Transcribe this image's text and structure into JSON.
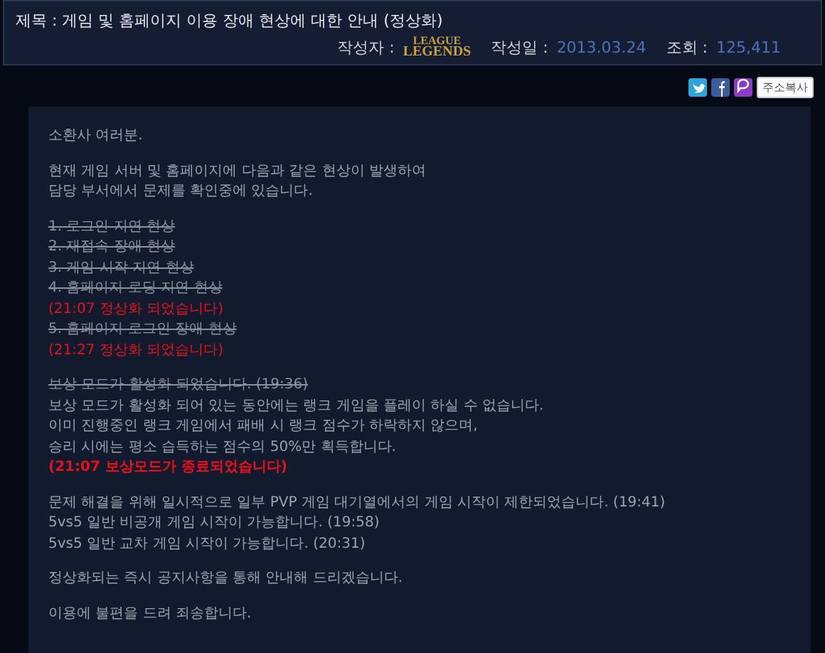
{
  "header": {
    "title": "제목 : 게임 및 홈페이지 이용 장애 현상에 대한 안내 (정상화)",
    "author_label": "작성자 :",
    "author_logo": [
      "LEAGUE",
      "LEGENDS"
    ],
    "date_label": "작성일 :",
    "date": "2013.03.24",
    "views_label": "조회 :",
    "views": "125,411"
  },
  "share": {
    "copy_button": "주소복사"
  },
  "paragraphs": [
    {
      "lines": [
        {
          "kind": "normal",
          "text": "소환사 여러분."
        }
      ]
    },
    {
      "lines": [
        {
          "kind": "normal",
          "text": "현재 게임 서버 및 홈페이지에 다음과 같은 현상이 발생하여"
        },
        {
          "kind": "normal",
          "text": "담당 부서에서 문제를 확인중에 있습니다."
        }
      ]
    },
    {
      "lines": [
        {
          "kind": "struck",
          "text": "1. 로그인 지연 현상"
        },
        {
          "kind": "struck",
          "text": "2. 재접속 장애 현상"
        },
        {
          "kind": "struck",
          "text": "3. 게임 시작 지연 현상"
        },
        {
          "kind": "struck",
          "text": "4. 홈페이지 로딩 지연 현상"
        },
        {
          "kind": "red",
          "text": "(21:07 정상화 되었습니다)"
        },
        {
          "kind": "struck",
          "text": "5. 홈페이지 로그인 장애 현상"
        },
        {
          "kind": "red",
          "text": "(21:27  정상화 되었습니다)"
        }
      ]
    },
    {
      "lines": [
        {
          "kind": "struck",
          "text": "보상 모드가 활성화 되었습니다. (19:36)"
        },
        {
          "kind": "normal",
          "text": "보상 모드가 활성화 되어 있는 동안에는 랭크 게임을 플레이 하실 수 없습니다."
        },
        {
          "kind": "normal",
          "text": "이미 진행중인 랭크 게임에서 패배 시 랭크 점수가 하락하지 않으며,"
        },
        {
          "kind": "normal",
          "text": "승리 시에는 평소 습득하는 점수의 50%만 획득합니다."
        },
        {
          "kind": "red-bold",
          "text": "(21:07 보상모드가 종료되었습니다)"
        }
      ]
    },
    {
      "lines": [
        {
          "kind": "normal",
          "text": "문제 해결을 위해 일시적으로 일부 PVP 게임 대기열에서의 게임 시작이 제한되었습니다. (19:41)"
        },
        {
          "kind": "normal",
          "text": "5vs5 일반 비공개 게임 시작이 가능합니다. (19:58)"
        },
        {
          "kind": "normal",
          "text": "5vs5 일반 교차 게임 시작이 가능합니다. (20:31)"
        }
      ]
    },
    {
      "lines": [
        {
          "kind": "normal",
          "text": "정상화되는 즉시 공지사항을 통해 안내해 드리겠습니다."
        }
      ]
    },
    {
      "lines": [
        {
          "kind": "normal",
          "text": "이용에 불편을 드려 죄송합니다."
        }
      ]
    }
  ]
}
